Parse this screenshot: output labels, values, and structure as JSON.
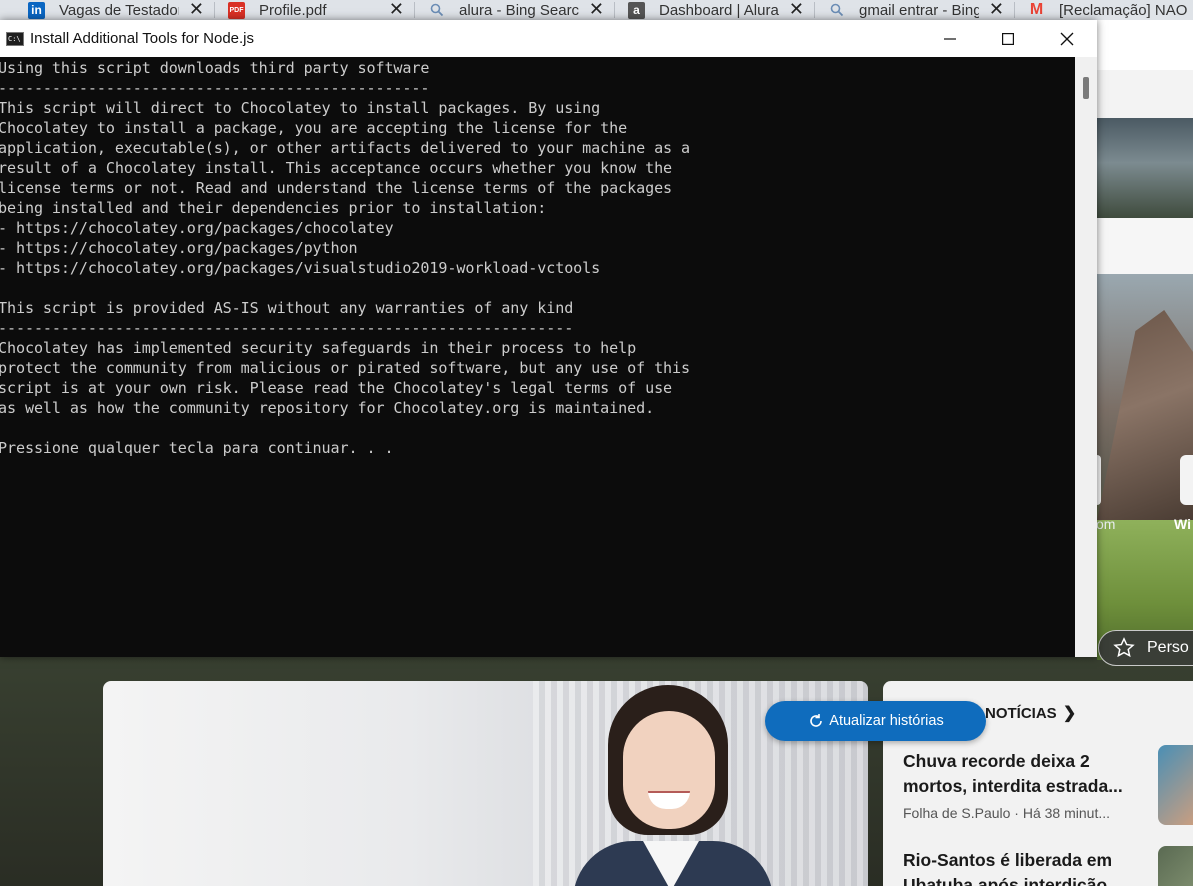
{
  "browser": {
    "tabs": [
      {
        "title": "Vagas de Testador",
        "favicon": "linkedin-icon",
        "favicon_label": "in",
        "favicon_color": "#0a66c2"
      },
      {
        "title": "Profile.pdf",
        "favicon": "pdf-icon",
        "favicon_label": "PDF",
        "favicon_color": "#d93025"
      },
      {
        "title": "alura - Bing Search",
        "favicon": "search-icon",
        "favicon_color": "#6b8db5"
      },
      {
        "title": "Dashboard | Alura",
        "favicon": "alura-icon",
        "favicon_label": "a",
        "favicon_color": "#555555"
      },
      {
        "title": "gmail entrar - Bing",
        "favicon": "search-icon",
        "favicon_color": "#6b8db5"
      },
      {
        "title": "[Reclamação] NAO",
        "favicon": "gmail-icon",
        "favicon_label": "M",
        "favicon_color": "#ea4335"
      }
    ]
  },
  "console": {
    "title": "Install Additional Tools for Node.js",
    "lines": [
      "Using this script downloads third party software",
      "------------------------------------------------",
      "This script will direct to Chocolatey to install packages. By using",
      "Chocolatey to install a package, you are accepting the license for the",
      "application, executable(s), or other artifacts delivered to your machine as a",
      "result of a Chocolatey install. This acceptance occurs whether you know the",
      "license terms or not. Read and understand the license terms of the packages",
      "being installed and their dependencies prior to installation:",
      "- https://chocolatey.org/packages/chocolatey",
      "- https://chocolatey.org/packages/python",
      "- https://chocolatey.org/packages/visualstudio2019-workload-vctools",
      "",
      "This script is provided AS-IS without any warranties of any kind",
      "----------------------------------------------------------------",
      "Chocolatey has implemented security safeguards in their process to help",
      "protect the community from malicious or pirated software, but any use of this",
      "script is at your own risk. Please read the Chocolatey's legal terms of use",
      "as well as how the community repository for Chocolatey.org is maintained.",
      "",
      "Pressione qualquer tecla para continuar. . ."
    ]
  },
  "background_page": {
    "personalize_label": "Perso",
    "right_strip_labels": [
      "om",
      "Wi"
    ],
    "refresh_button": "Atualizar histórias",
    "news_header": "NOTÍCIAS",
    "news_items": [
      {
        "title": "Chuva recorde deixa 2 mortos, interdita estrada...",
        "meta": "Folha de S.Paulo · Há 38 minut..."
      },
      {
        "title": "Rio-Santos é liberada em Ubatuba após interdição",
        "meta": ""
      }
    ]
  },
  "colors": {
    "console_bg": "#0c0c0c",
    "console_text": "#cccccc",
    "accent_blue": "#0f6cbd"
  }
}
